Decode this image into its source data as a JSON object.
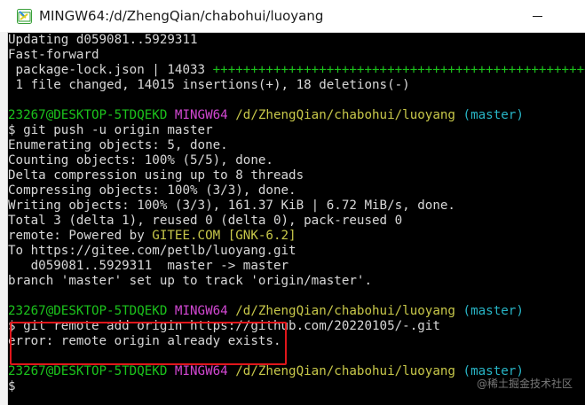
{
  "window": {
    "title": "MINGW64:/d/ZhengQian/chabohui/luoyang",
    "icon": "mingw-terminal-icon"
  },
  "terminal": {
    "pull_lines": {
      "updating": "Updating d059081..5929311",
      "fast_forward": "Fast-forward",
      "file_stat_name": " package-lock.json | 14033 ",
      "file_stat_plus": "++++++++++++++++++++++++++++++++++++++++++++++++++",
      "summary": " 1 file changed, 14015 insertions(+), 18 deletions(-)"
    },
    "prompt": {
      "user_host": "23267@DESKTOP-5TDQEKD",
      "system": "MINGW64",
      "path": "/d/ZhengQian/chabohui/luoyang",
      "branch": "(master)",
      "symbol": "$"
    },
    "push": {
      "command": " git push -u origin master",
      "output": [
        "Enumerating objects: 5, done.",
        "Counting objects: 100% (5/5), done.",
        "Delta compression using up to 8 threads",
        "Compressing objects: 100% (3/3), done.",
        "Writing objects: 100% (3/3), 161.37 KiB | 6.72 MiB/s, done.",
        "Total 3 (delta 1), reused 0 (delta 0), pack-reused 0"
      ],
      "remote_prefix": "remote: Powered by ",
      "remote_host": "GITEE.COM",
      "remote_space": " ",
      "remote_tag": "[GNK-6.2]",
      "to_line": "To https://gitee.com/petlb/luoyang.git",
      "ref_line": "   d059081..5929311  master -> master",
      "branch_line": "branch 'master' set up to track 'origin/master'."
    },
    "remote_add": {
      "command": " git remote add origin https://github.com/20220105/-.git",
      "error": "error: remote origin already exists."
    }
  },
  "watermark": "@稀土掘金技术社区",
  "colors": {
    "green": "#1cc31c",
    "magenta": "#d348d3",
    "yellow": "#c8c84a",
    "cyan": "#28b5c6",
    "highlight": "#e0161b"
  }
}
